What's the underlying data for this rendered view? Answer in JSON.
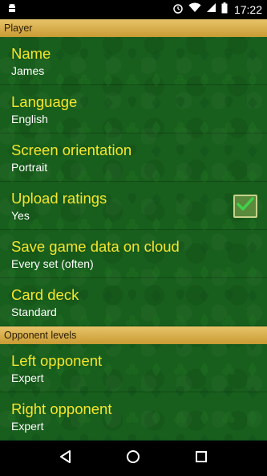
{
  "status_bar": {
    "time": "17:22",
    "icons": [
      "android-debug-icon",
      "alarm-icon",
      "wifi-icon",
      "signal-icon",
      "battery-icon"
    ]
  },
  "sections": [
    {
      "header": "Player",
      "items": [
        {
          "title": "Name",
          "summary": "James"
        },
        {
          "title": "Language",
          "summary": "English"
        },
        {
          "title": "Screen orientation",
          "summary": "Portrait"
        },
        {
          "title": "Upload ratings",
          "summary": "Yes",
          "checked": true
        },
        {
          "title": "Save game data on cloud",
          "summary": "Every set (often)"
        },
        {
          "title": "Card deck",
          "summary": "Standard"
        }
      ]
    },
    {
      "header": "Opponent levels",
      "items": [
        {
          "title": "Left opponent",
          "summary": "Expert"
        },
        {
          "title": "Right opponent",
          "summary": "Expert"
        }
      ]
    }
  ],
  "nav_bar": {
    "buttons": [
      "back-icon",
      "home-icon",
      "recents-icon"
    ]
  }
}
